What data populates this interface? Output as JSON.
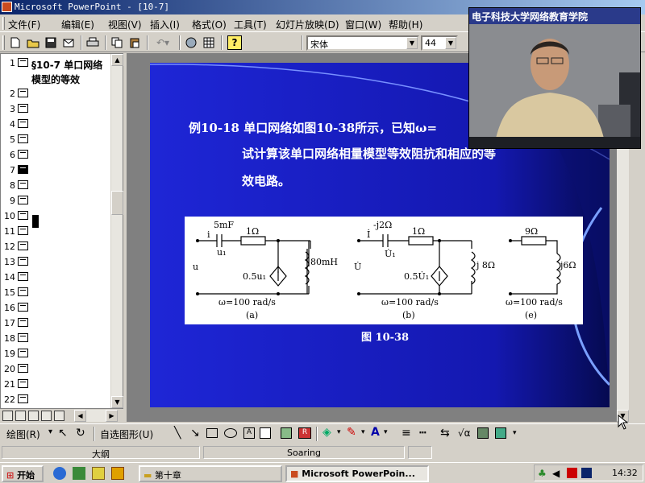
{
  "window": {
    "title": "Microsoft PowerPoint - [10-7]"
  },
  "menu": [
    "文件(F)",
    "编辑(E)",
    "视图(V)",
    "插入(I)",
    "格式(O)",
    "工具(T)",
    "幻灯片放映(D)",
    "窗口(W)",
    "帮助(H)"
  ],
  "toolbar": {
    "font_name": "宋体",
    "font_size": "44"
  },
  "outline": {
    "slide1_line1": "§10-7 单口网络",
    "slide1_line2": "模型的等效",
    "numbers": [
      "1",
      "2",
      "3",
      "4",
      "5",
      "6",
      "7",
      "8",
      "9",
      "10",
      "11",
      "12",
      "13",
      "14",
      "15",
      "16",
      "17",
      "18",
      "19",
      "20",
      "21",
      "22"
    ],
    "selected": "7"
  },
  "slide": {
    "text_line1": "例10-18 单口网络如图10-38所示，已知ω=",
    "text_line2": "试计算该单口网络相量模型等效阻抗和相应的等",
    "text_line3": "效电路。",
    "figure_caption": "图 10-38",
    "fig_a": {
      "cap": "5mF",
      "res": "1Ω",
      "ind": "80mH",
      "src": "0.5u₁",
      "u1": "u₁",
      "cur": "i",
      "port": "u",
      "omega": "ω=100 rad/s",
      "label": "(a)"
    },
    "fig_b": {
      "cap": "-j2Ω",
      "res": "1Ω",
      "ind": "j 8Ω",
      "src": "0.5U̇₁",
      "u1": "U̇₁",
      "cur": "İ",
      "port": "U̇",
      "omega": "ω=100 rad/s",
      "label": "(b)"
    },
    "fig_c": {
      "res": "9Ω",
      "ind": "j6Ω",
      "omega": "ω=100 rad/s",
      "label": "(e)"
    }
  },
  "video": {
    "caption": "电子科技大学网络教育学院"
  },
  "drawing_toolbar": {
    "draw_label": "绘图(R)",
    "autoshape_label": "自选图形(U)"
  },
  "status": {
    "layout": "大纲",
    "design": "Soaring"
  },
  "taskbar": {
    "start": "开始",
    "folder": "第十章",
    "app": "Microsoft PowerPoin...",
    "clock": "14:32"
  }
}
